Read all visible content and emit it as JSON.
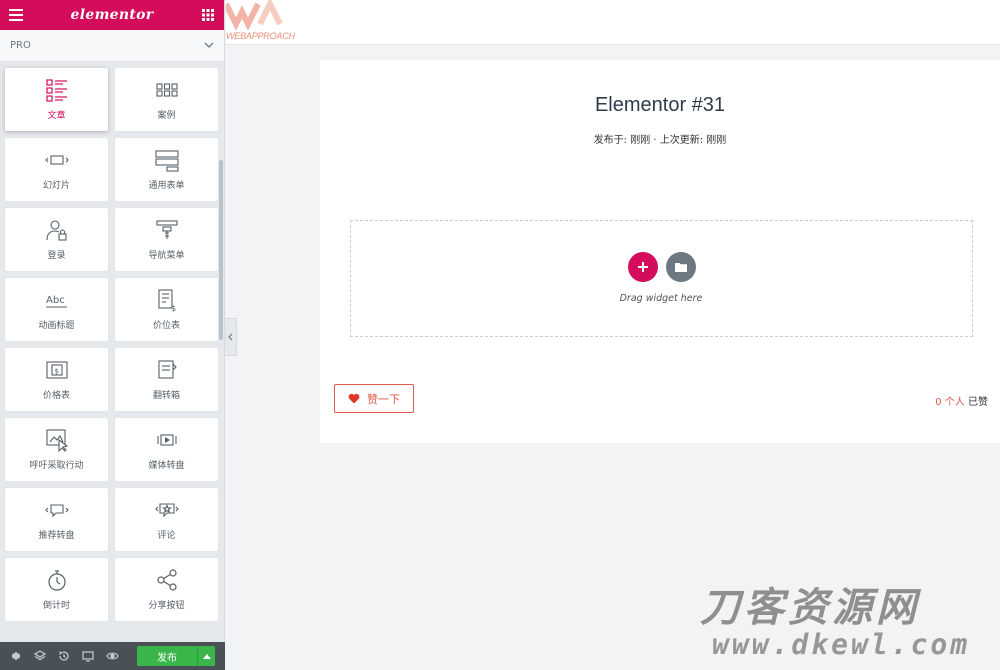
{
  "sidebar": {
    "logo": "elementor",
    "section_label": "PRO",
    "widgets": [
      {
        "label": "文章",
        "icon": "posts-icon",
        "active": true
      },
      {
        "label": "案例",
        "icon": "portfolio-icon"
      },
      {
        "label": "幻灯片",
        "icon": "slides-icon"
      },
      {
        "label": "通用表单",
        "icon": "form-icon"
      },
      {
        "label": "登录",
        "icon": "login-icon"
      },
      {
        "label": "导航菜单",
        "icon": "nav-menu-icon"
      },
      {
        "label": "动画标题",
        "icon": "animated-headline-icon"
      },
      {
        "label": "价位表",
        "icon": "price-list-icon"
      },
      {
        "label": "价格表",
        "icon": "price-table-icon"
      },
      {
        "label": "翻转箱",
        "icon": "flip-box-icon"
      },
      {
        "label": "呼吁采取行动",
        "icon": "call-to-action-icon"
      },
      {
        "label": "媒体转盘",
        "icon": "media-carousel-icon"
      },
      {
        "label": "推荐转盘",
        "icon": "testimonial-carousel-icon"
      },
      {
        "label": "评论",
        "icon": "reviews-icon"
      },
      {
        "label": "倒计时",
        "icon": "countdown-icon"
      },
      {
        "label": "分享按钮",
        "icon": "share-buttons-icon"
      }
    ],
    "footer": {
      "publish_label": "发布"
    }
  },
  "header": {
    "brand_text": "WEBAPPROACH"
  },
  "article": {
    "title": "Elementor #31",
    "meta": "发布于: 刚刚 · 上次更新: 刚刚",
    "drop_text": "Drag widget here",
    "like_label": "赞一下",
    "like_count": "0 个人",
    "like_suffix": " 已赞"
  },
  "watermark": {
    "line1": "刀客资源网",
    "line2": "www.dkewl.com"
  },
  "colors": {
    "brand": "#d30c5c",
    "publish": "#39b54a",
    "like": "#e05a4a"
  }
}
